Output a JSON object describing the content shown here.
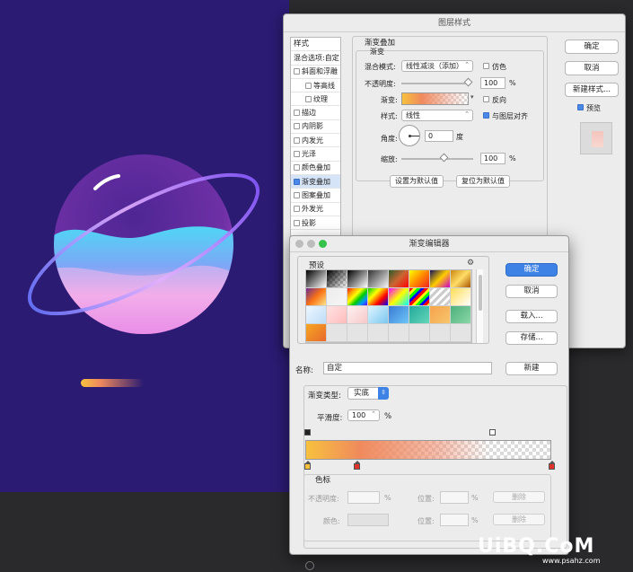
{
  "layer_style": {
    "title": "图层样式",
    "sidebar": {
      "header": "样式",
      "blend": "混合选项:自定",
      "items": [
        {
          "label": "斜面和浮雕",
          "checked": false,
          "indent": false
        },
        {
          "label": "等高线",
          "checked": false,
          "indent": true
        },
        {
          "label": "纹理",
          "checked": false,
          "indent": true
        },
        {
          "label": "描边",
          "checked": false,
          "indent": false
        },
        {
          "label": "内阴影",
          "checked": false,
          "indent": false
        },
        {
          "label": "内发光",
          "checked": false,
          "indent": false
        },
        {
          "label": "光泽",
          "checked": false,
          "indent": false
        },
        {
          "label": "颜色叠加",
          "checked": false,
          "indent": false
        },
        {
          "label": "渐变叠加",
          "checked": true,
          "indent": false,
          "active": true
        },
        {
          "label": "图案叠加",
          "checked": false,
          "indent": false
        },
        {
          "label": "外发光",
          "checked": false,
          "indent": false
        },
        {
          "label": "投影",
          "checked": false,
          "indent": false
        }
      ]
    },
    "panel": {
      "group_title": "渐变叠加",
      "sub_title": "渐变",
      "blend_mode_label": "混合模式:",
      "blend_mode_value": "线性减淡（添加）",
      "dither_label": "仿色",
      "opacity_label": "不透明度:",
      "opacity_value": "100",
      "percent": "%",
      "gradient_label": "渐变:",
      "reverse_label": "反向",
      "style_label": "样式:",
      "style_value": "线性",
      "align_label": "与图层对齐",
      "angle_label": "角度:",
      "angle_value": "0",
      "degree": "度",
      "scale_label": "缩放:",
      "scale_value": "100",
      "set_default_btn": "设置为默认值",
      "reset_default_btn": "复位为默认值"
    },
    "buttons": {
      "ok": "确定",
      "cancel": "取消",
      "new_style": "新建样式...",
      "preview": "预览"
    }
  },
  "gradient_editor": {
    "title": "渐变编辑器",
    "presets_label": "预设",
    "buttons": {
      "ok": "确定",
      "cancel": "取消",
      "load": "载入...",
      "save": "存储...",
      "new": "新建"
    },
    "name_label": "名称:",
    "name_value": "自定",
    "type_label": "渐变类型:",
    "type_value": "实底",
    "smooth_label": "平滑度:",
    "smooth_value": "100",
    "percent": "%",
    "stops_group": "色标",
    "stop_opacity_label": "不透明度:",
    "stop_location_label": "位置:",
    "stop_color_label": "颜色:",
    "delete_btn": "删除"
  },
  "watermark": {
    "main": "UiBQ.CoM",
    "sub": "www.psahz.com"
  }
}
